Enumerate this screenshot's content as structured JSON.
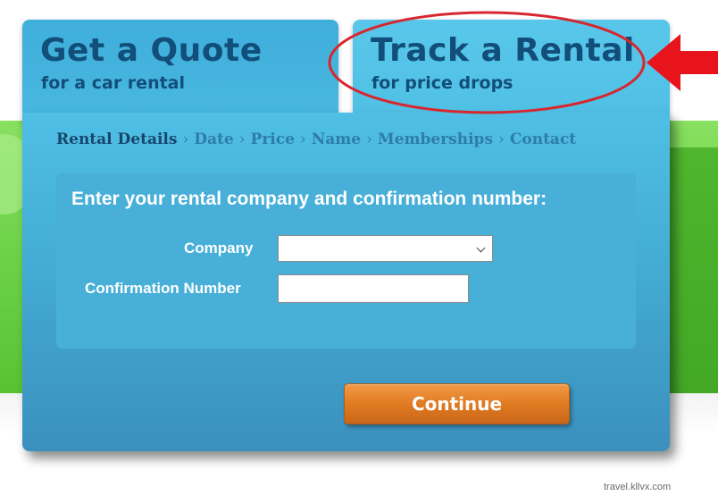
{
  "tabs": [
    {
      "title": "Get a Quote",
      "subtitle": "for a car rental"
    },
    {
      "title": "Track a Rental",
      "subtitle": "for price drops"
    }
  ],
  "breadcrumb": {
    "items": [
      "Rental Details",
      "Date",
      "Price",
      "Name",
      "Memberships",
      "Contact"
    ],
    "separator": "›"
  },
  "form": {
    "heading": "Enter your rental company and confirmation number:",
    "company_label": "Company",
    "company_value": "",
    "confirmation_label": "Confirmation Number",
    "confirmation_value": ""
  },
  "continue_label": "Continue",
  "annotation": {
    "ellipse_color": "#d8262e",
    "arrow_color": "#e8141c"
  },
  "watermark": "travel.kllvx.com",
  "colors": {
    "tab_text": "#124e7a",
    "panel_blue": "#44aed6",
    "button_orange": "#e07b22",
    "background_green": "#6fd34a"
  }
}
